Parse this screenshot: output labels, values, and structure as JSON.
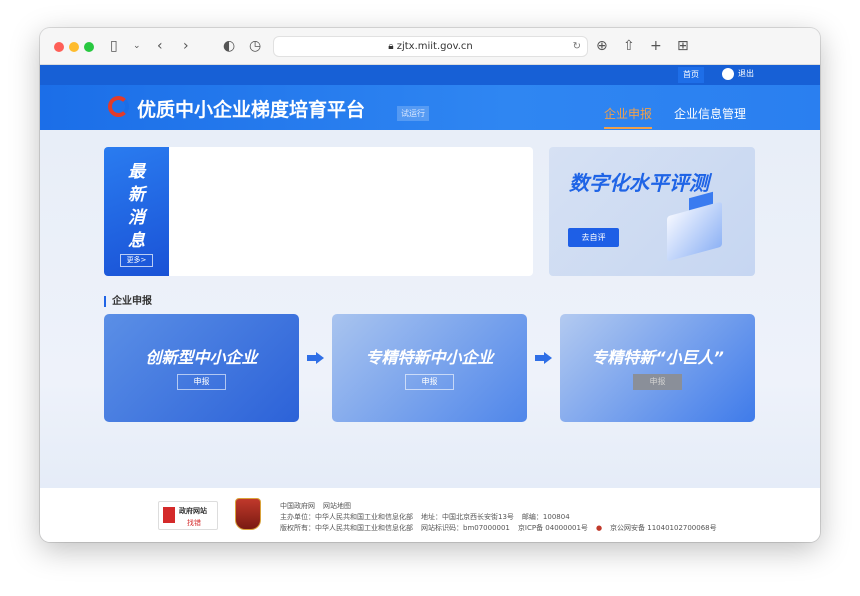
{
  "browser": {
    "url": "zjtx.miit.gov.cn"
  },
  "topbar": {
    "home": "首页",
    "logout": "退出"
  },
  "header": {
    "title": "优质中小企业梯度培育平台",
    "badge": "试运行",
    "nav": [
      {
        "label": "企业申报",
        "active": true
      },
      {
        "label": "企业信息管理",
        "active": false
      }
    ]
  },
  "news": {
    "chars": [
      "最",
      "新",
      "消",
      "息"
    ],
    "more": "更多>"
  },
  "evaluation": {
    "title": "数字化水平评测",
    "button": "去自评"
  },
  "section": {
    "title": "企业申报"
  },
  "cards": [
    {
      "name": "创新型中小企业",
      "button": "申报",
      "enabled": true
    },
    {
      "name": "专精特新中小企业",
      "button": "申报",
      "enabled": true
    },
    {
      "name": "专精特新“小巨人”",
      "button": "申报",
      "enabled": false
    }
  ],
  "footer": {
    "badge1_top": "政府网站",
    "badge1_bottom": "找错",
    "links": [
      "中国政府网",
      "网站地图"
    ],
    "line2": [
      "主办单位：中华人民共和国工业和信息化部",
      "地址：中国北京西长安街13号",
      "邮编：100804"
    ],
    "line3": [
      "版权所有：中华人民共和国工业和信息化部",
      "网站标识码：bm07000001",
      "京ICP备 04000001号",
      "京公网安备 11040102700068号"
    ]
  },
  "colors": {
    "brand": "#1b6ee8",
    "accent": "#f0a04b"
  }
}
